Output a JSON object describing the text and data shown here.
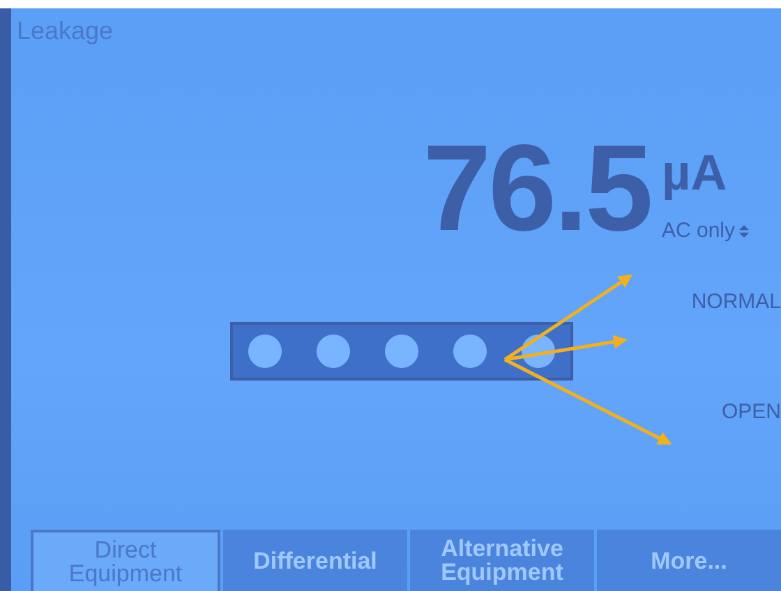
{
  "screen": {
    "title": "Leakage"
  },
  "reading": {
    "value": "76.5",
    "unit": "µA",
    "mode": "AC only"
  },
  "labels": {
    "normal": "NORMAL",
    "open": "OPEN"
  },
  "softkeys": [
    {
      "label": "Direct Equipment",
      "selected": true
    },
    {
      "label": "Differential",
      "selected": false
    },
    {
      "label": "Alternative Equipment",
      "selected": false
    },
    {
      "label": "More...",
      "selected": false
    }
  ]
}
